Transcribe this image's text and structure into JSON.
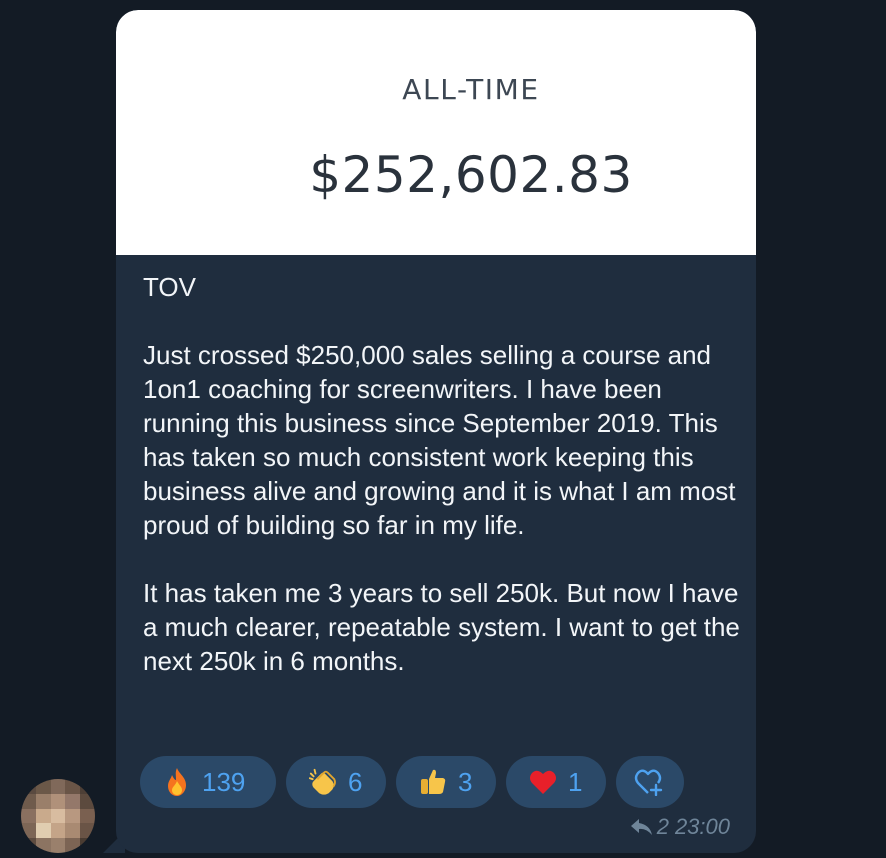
{
  "media": {
    "label": "ALL-TIME",
    "amount": "$252,602.83"
  },
  "message": {
    "title": "TOV",
    "paragraph1": "Just crossed $250,000 sales selling a course and 1on1 coaching for screenwriters. I have been running this business since September 2019. This has taken so much consistent work keeping this business alive and growing and it is what I am most proud of building so far in my life.",
    "paragraph2": "It has taken me 3 years to sell 250k. But now I have a much clearer, repeatable system. I want to get the next 250k in 6 months."
  },
  "reactions": [
    {
      "icon": "fire-icon",
      "count": "139"
    },
    {
      "icon": "clapping-hands-icon",
      "count": "6"
    },
    {
      "icon": "thumbs-up-icon",
      "count": "3"
    },
    {
      "icon": "red-heart-icon",
      "count": "1"
    }
  ],
  "meta": {
    "reply_count": "2",
    "time": "23:00"
  },
  "colors": {
    "background": "#131b25",
    "bubble": "#1f2d3e",
    "reaction_bg": "#2b4968",
    "reaction_text": "#4ea2f0"
  }
}
